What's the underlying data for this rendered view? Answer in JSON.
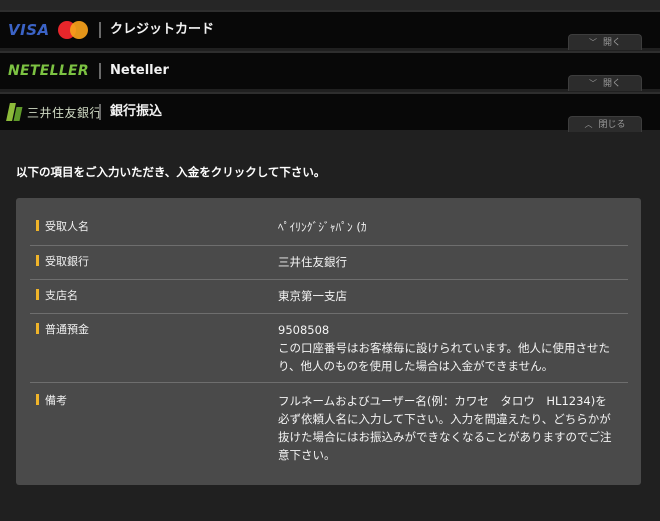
{
  "methods": [
    {
      "id": "card",
      "label": "クレジットカード",
      "logo_text": "VISA",
      "logo_icon": "mastercard-icon",
      "toggle_label": "開く",
      "toggle_icon": "chevron-down"
    },
    {
      "id": "neteller",
      "label": "Neteller",
      "logo_text": "NETELLER",
      "toggle_label": "開く",
      "toggle_icon": "chevron-down"
    },
    {
      "id": "bank",
      "label": "銀行振込",
      "logo_text": "三井住友銀行",
      "logo_icon": "smbc-mark-icon",
      "toggle_label": "閉じる",
      "toggle_icon": "chevron-up"
    }
  ],
  "bank_transfer": {
    "instruction": "以下の項目をご入力いただき、入金をクリックして下さい。",
    "rows": [
      {
        "label": "受取人名",
        "value": "ﾍﾟｲﾘﾝｸﾞｼﾞｬﾊﾟﾝ (ｶ"
      },
      {
        "label": "受取銀行",
        "value": "三井住友銀行"
      },
      {
        "label": "支店名",
        "value": "東京第一支店"
      },
      {
        "label": "普通預金",
        "value": "9508508",
        "note": "この口座番号はお客様毎に設けられています。他人に使用させたり、他人のものを使用した場合は入金ができません。"
      },
      {
        "label": "備考",
        "value": "フルネームおよびユーザー名(例：カワセ　タロウ　HL1234)を必ず依頼人名に入力して下さい。入力を間違えたり、どちらかが抜けた場合にはお振込みができなくなることがありますのでご注意下さい。"
      }
    ]
  },
  "colors": {
    "accent_bar": "#f0b429",
    "visa_blue": "#3b63c6",
    "neteller_green": "#7cc242",
    "smbc_green": "#8dbb3a"
  }
}
